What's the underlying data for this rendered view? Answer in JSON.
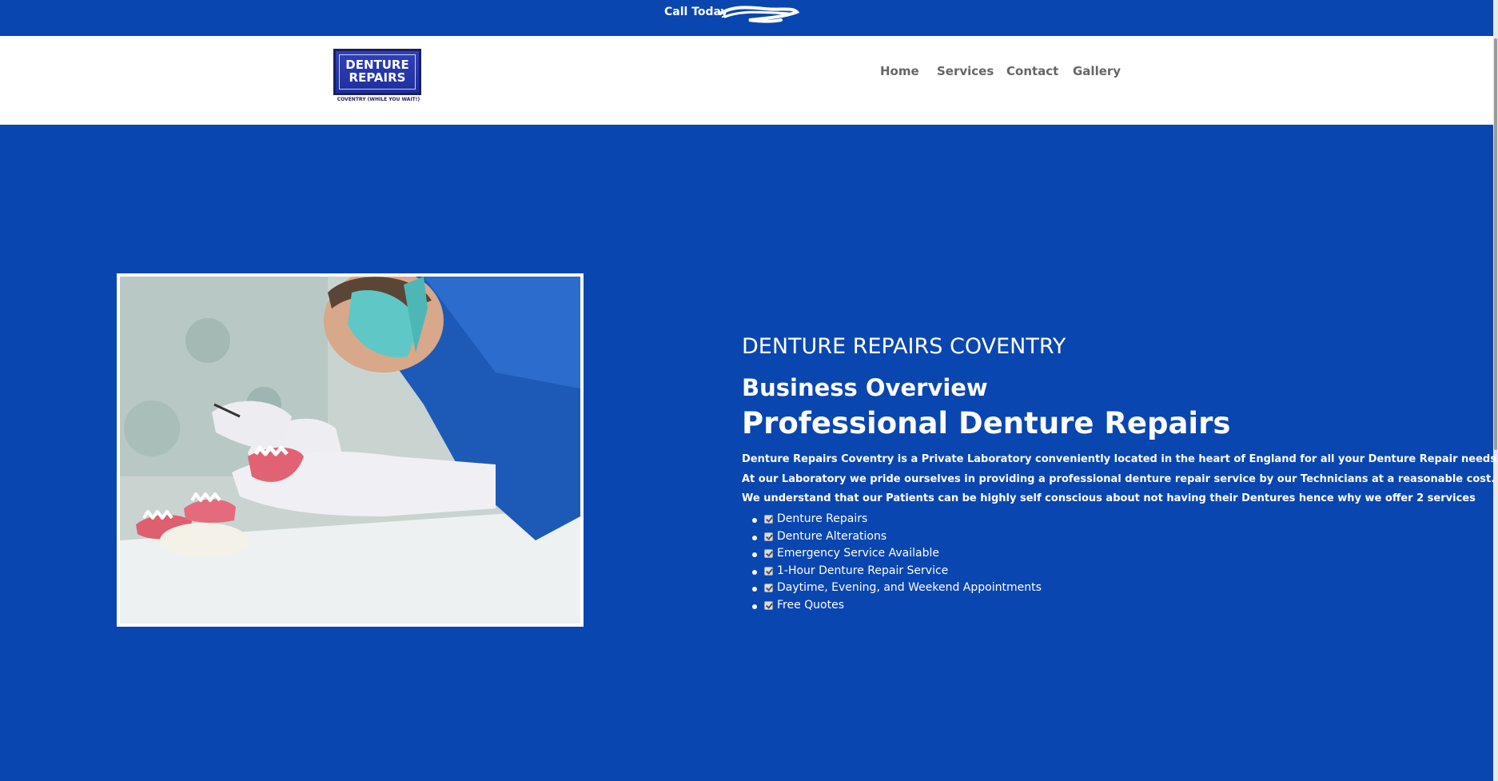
{
  "topbar": {
    "call_label": "Call Today"
  },
  "logo": {
    "line1": "DENTURE",
    "line2": "REPAIRS",
    "tagline": "COVENTRY (WHILE YOU WAIT!)"
  },
  "nav": {
    "items": [
      "Home",
      "Services",
      "Contact",
      "Gallery"
    ]
  },
  "hero": {
    "eyebrow": "DENTURE REPAIRS COVENTRY",
    "subtitle": "Business Overview",
    "title": "Professional Denture Repairs",
    "paragraphs": [
      "Denture Repairs Coventry is a Private Laboratory conveniently located in the heart of England for all your Denture Repair needs.",
      "At our Laboratory we pride ourselves in providing a professional denture repair service by our Technicians at a reasonable cost.",
      "We understand that our Patients can be highly self conscious about not having their Dentures hence why we offer 2 services"
    ],
    "services": [
      "Denture Repairs",
      "Denture Alterations",
      "Emergency Service Available",
      "1-Hour Denture Repair Service",
      "Daytime, Evening, and Weekend Appointments",
      "Free Quotes"
    ]
  },
  "colors": {
    "brand_blue": "#0a46b0",
    "logo_navy": "#1b1f5e",
    "nav_text": "#666666"
  }
}
